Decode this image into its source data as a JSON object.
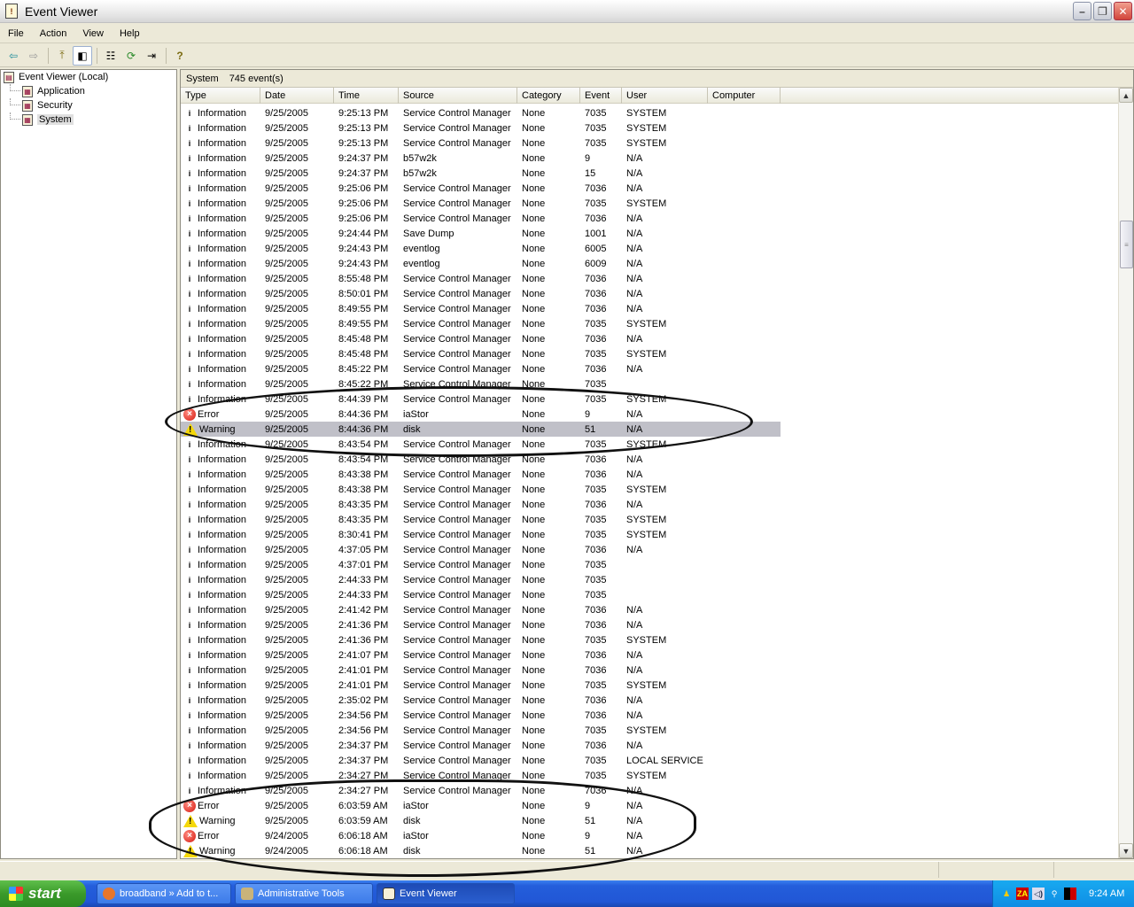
{
  "window": {
    "title": "Event Viewer",
    "minimize_label": "–",
    "restore_label": "❐",
    "close_label": "✕"
  },
  "menu": [
    "File",
    "Action",
    "View",
    "Help"
  ],
  "toolbar": {
    "back": "⇦",
    "forward": "⇨",
    "up": "⤒",
    "show_hide_tree": "◧",
    "properties": "☷",
    "refresh": "⟳",
    "export": "⇥",
    "help": "?"
  },
  "tree": {
    "root": "Event Viewer (Local)",
    "children": [
      "Application",
      "Security",
      "System"
    ],
    "selected": "System"
  },
  "pane": {
    "log_name": "System",
    "event_count": "745 event(s)"
  },
  "columns": [
    "Type",
    "Date",
    "Time",
    "Source",
    "Category",
    "Event",
    "User",
    "Computer"
  ],
  "rows": [
    {
      "type": "Information",
      "date": "9/25/2005",
      "time": "9:25:13 PM",
      "source": "Service Control Manager",
      "category": "None",
      "event": "7035",
      "user": "SYSTEM"
    },
    {
      "type": "Information",
      "date": "9/25/2005",
      "time": "9:25:13 PM",
      "source": "Service Control Manager",
      "category": "None",
      "event": "7035",
      "user": "SYSTEM"
    },
    {
      "type": "Information",
      "date": "9/25/2005",
      "time": "9:25:13 PM",
      "source": "Service Control Manager",
      "category": "None",
      "event": "7035",
      "user": "SYSTEM"
    },
    {
      "type": "Information",
      "date": "9/25/2005",
      "time": "9:24:37 PM",
      "source": "b57w2k",
      "category": "None",
      "event": "9",
      "user": "N/A"
    },
    {
      "type": "Information",
      "date": "9/25/2005",
      "time": "9:24:37 PM",
      "source": "b57w2k",
      "category": "None",
      "event": "15",
      "user": "N/A"
    },
    {
      "type": "Information",
      "date": "9/25/2005",
      "time": "9:25:06 PM",
      "source": "Service Control Manager",
      "category": "None",
      "event": "7036",
      "user": "N/A"
    },
    {
      "type": "Information",
      "date": "9/25/2005",
      "time": "9:25:06 PM",
      "source": "Service Control Manager",
      "category": "None",
      "event": "7035",
      "user": "SYSTEM"
    },
    {
      "type": "Information",
      "date": "9/25/2005",
      "time": "9:25:06 PM",
      "source": "Service Control Manager",
      "category": "None",
      "event": "7036",
      "user": "N/A"
    },
    {
      "type": "Information",
      "date": "9/25/2005",
      "time": "9:24:44 PM",
      "source": "Save Dump",
      "category": "None",
      "event": "1001",
      "user": "N/A"
    },
    {
      "type": "Information",
      "date": "9/25/2005",
      "time": "9:24:43 PM",
      "source": "eventlog",
      "category": "None",
      "event": "6005",
      "user": "N/A"
    },
    {
      "type": "Information",
      "date": "9/25/2005",
      "time": "9:24:43 PM",
      "source": "eventlog",
      "category": "None",
      "event": "6009",
      "user": "N/A"
    },
    {
      "type": "Information",
      "date": "9/25/2005",
      "time": "8:55:48 PM",
      "source": "Service Control Manager",
      "category": "None",
      "event": "7036",
      "user": "N/A"
    },
    {
      "type": "Information",
      "date": "9/25/2005",
      "time": "8:50:01 PM",
      "source": "Service Control Manager",
      "category": "None",
      "event": "7036",
      "user": "N/A"
    },
    {
      "type": "Information",
      "date": "9/25/2005",
      "time": "8:49:55 PM",
      "source": "Service Control Manager",
      "category": "None",
      "event": "7036",
      "user": "N/A"
    },
    {
      "type": "Information",
      "date": "9/25/2005",
      "time": "8:49:55 PM",
      "source": "Service Control Manager",
      "category": "None",
      "event": "7035",
      "user": "SYSTEM"
    },
    {
      "type": "Information",
      "date": "9/25/2005",
      "time": "8:45:48 PM",
      "source": "Service Control Manager",
      "category": "None",
      "event": "7036",
      "user": "N/A"
    },
    {
      "type": "Information",
      "date": "9/25/2005",
      "time": "8:45:48 PM",
      "source": "Service Control Manager",
      "category": "None",
      "event": "7035",
      "user": "SYSTEM"
    },
    {
      "type": "Information",
      "date": "9/25/2005",
      "time": "8:45:22 PM",
      "source": "Service Control Manager",
      "category": "None",
      "event": "7036",
      "user": "N/A"
    },
    {
      "type": "Information",
      "date": "9/25/2005",
      "time": "8:45:22 PM",
      "source": "Service Control Manager",
      "category": "None",
      "event": "7035",
      "user": ""
    },
    {
      "type": "Information",
      "date": "9/25/2005",
      "time": "8:44:39 PM",
      "source": "Service Control Manager",
      "category": "None",
      "event": "7035",
      "user": "SYSTEM"
    },
    {
      "type": "Error",
      "date": "9/25/2005",
      "time": "8:44:36 PM",
      "source": "iaStor",
      "category": "None",
      "event": "9",
      "user": "N/A"
    },
    {
      "type": "Warning",
      "date": "9/25/2005",
      "time": "8:44:36 PM",
      "source": "disk",
      "category": "None",
      "event": "51",
      "user": "N/A",
      "selected": true
    },
    {
      "type": "Information",
      "date": "9/25/2005",
      "time": "8:43:54 PM",
      "source": "Service Control Manager",
      "category": "None",
      "event": "7035",
      "user": "SYSTEM"
    },
    {
      "type": "Information",
      "date": "9/25/2005",
      "time": "8:43:54 PM",
      "source": "Service Control Manager",
      "category": "None",
      "event": "7036",
      "user": "N/A"
    },
    {
      "type": "Information",
      "date": "9/25/2005",
      "time": "8:43:38 PM",
      "source": "Service Control Manager",
      "category": "None",
      "event": "7036",
      "user": "N/A"
    },
    {
      "type": "Information",
      "date": "9/25/2005",
      "time": "8:43:38 PM",
      "source": "Service Control Manager",
      "category": "None",
      "event": "7035",
      "user": "SYSTEM"
    },
    {
      "type": "Information",
      "date": "9/25/2005",
      "time": "8:43:35 PM",
      "source": "Service Control Manager",
      "category": "None",
      "event": "7036",
      "user": "N/A"
    },
    {
      "type": "Information",
      "date": "9/25/2005",
      "time": "8:43:35 PM",
      "source": "Service Control Manager",
      "category": "None",
      "event": "7035",
      "user": "SYSTEM"
    },
    {
      "type": "Information",
      "date": "9/25/2005",
      "time": "8:30:41 PM",
      "source": "Service Control Manager",
      "category": "None",
      "event": "7035",
      "user": "SYSTEM"
    },
    {
      "type": "Information",
      "date": "9/25/2005",
      "time": "4:37:05 PM",
      "source": "Service Control Manager",
      "category": "None",
      "event": "7036",
      "user": "N/A"
    },
    {
      "type": "Information",
      "date": "9/25/2005",
      "time": "4:37:01 PM",
      "source": "Service Control Manager",
      "category": "None",
      "event": "7035",
      "user": ""
    },
    {
      "type": "Information",
      "date": "9/25/2005",
      "time": "2:44:33 PM",
      "source": "Service Control Manager",
      "category": "None",
      "event": "7035",
      "user": ""
    },
    {
      "type": "Information",
      "date": "9/25/2005",
      "time": "2:44:33 PM",
      "source": "Service Control Manager",
      "category": "None",
      "event": "7035",
      "user": ""
    },
    {
      "type": "Information",
      "date": "9/25/2005",
      "time": "2:41:42 PM",
      "source": "Service Control Manager",
      "category": "None",
      "event": "7036",
      "user": "N/A"
    },
    {
      "type": "Information",
      "date": "9/25/2005",
      "time": "2:41:36 PM",
      "source": "Service Control Manager",
      "category": "None",
      "event": "7036",
      "user": "N/A"
    },
    {
      "type": "Information",
      "date": "9/25/2005",
      "time": "2:41:36 PM",
      "source": "Service Control Manager",
      "category": "None",
      "event": "7035",
      "user": "SYSTEM"
    },
    {
      "type": "Information",
      "date": "9/25/2005",
      "time": "2:41:07 PM",
      "source": "Service Control Manager",
      "category": "None",
      "event": "7036",
      "user": "N/A"
    },
    {
      "type": "Information",
      "date": "9/25/2005",
      "time": "2:41:01 PM",
      "source": "Service Control Manager",
      "category": "None",
      "event": "7036",
      "user": "N/A"
    },
    {
      "type": "Information",
      "date": "9/25/2005",
      "time": "2:41:01 PM",
      "source": "Service Control Manager",
      "category": "None",
      "event": "7035",
      "user": "SYSTEM"
    },
    {
      "type": "Information",
      "date": "9/25/2005",
      "time": "2:35:02 PM",
      "source": "Service Control Manager",
      "category": "None",
      "event": "7036",
      "user": "N/A"
    },
    {
      "type": "Information",
      "date": "9/25/2005",
      "time": "2:34:56 PM",
      "source": "Service Control Manager",
      "category": "None",
      "event": "7036",
      "user": "N/A"
    },
    {
      "type": "Information",
      "date": "9/25/2005",
      "time": "2:34:56 PM",
      "source": "Service Control Manager",
      "category": "None",
      "event": "7035",
      "user": "SYSTEM"
    },
    {
      "type": "Information",
      "date": "9/25/2005",
      "time": "2:34:37 PM",
      "source": "Service Control Manager",
      "category": "None",
      "event": "7036",
      "user": "N/A"
    },
    {
      "type": "Information",
      "date": "9/25/2005",
      "time": "2:34:37 PM",
      "source": "Service Control Manager",
      "category": "None",
      "event": "7035",
      "user": "LOCAL SERVICE"
    },
    {
      "type": "Information",
      "date": "9/25/2005",
      "time": "2:34:27 PM",
      "source": "Service Control Manager",
      "category": "None",
      "event": "7035",
      "user": "SYSTEM"
    },
    {
      "type": "Information",
      "date": "9/25/2005",
      "time": "2:34:27 PM",
      "source": "Service Control Manager",
      "category": "None",
      "event": "7036",
      "user": "N/A"
    },
    {
      "type": "Error",
      "date": "9/25/2005",
      "time": "6:03:59 AM",
      "source": "iaStor",
      "category": "None",
      "event": "9",
      "user": "N/A"
    },
    {
      "type": "Warning",
      "date": "9/25/2005",
      "time": "6:03:59 AM",
      "source": "disk",
      "category": "None",
      "event": "51",
      "user": "N/A"
    },
    {
      "type": "Error",
      "date": "9/24/2005",
      "time": "6:06:18 AM",
      "source": "iaStor",
      "category": "None",
      "event": "9",
      "user": "N/A"
    },
    {
      "type": "Warning",
      "date": "9/24/2005",
      "time": "6:06:18 AM",
      "source": "disk",
      "category": "None",
      "event": "51",
      "user": "N/A"
    }
  ],
  "taskbar": {
    "start_label": "start",
    "tasks": [
      {
        "label": "broadband » Add to t...",
        "icon": "firefox-icon",
        "color": "#e8762b"
      },
      {
        "label": "Administrative Tools",
        "icon": "admin-tools-icon",
        "color": "#c9b37a"
      },
      {
        "label": "Event Viewer",
        "icon": "event-viewer-icon",
        "color": "#f6f0d8",
        "active": true
      }
    ],
    "clock": "9:24 AM"
  }
}
